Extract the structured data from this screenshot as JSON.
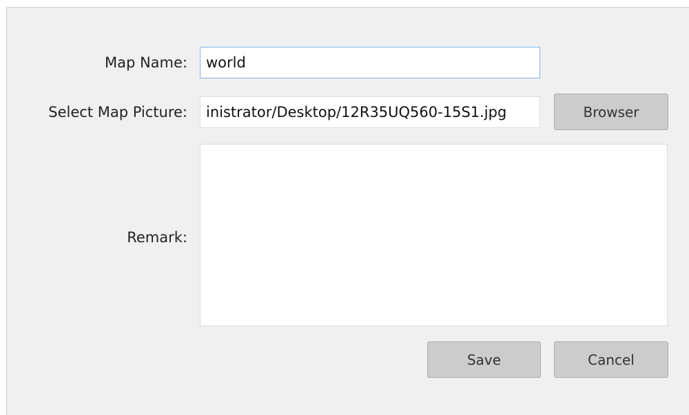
{
  "form": {
    "map_name_label": "Map Name:",
    "map_name_value": "world",
    "select_picture_label": "Select Map Picture:",
    "picture_path_value": "inistrator/Desktop/12R35UQ560-15S1.jpg",
    "browser_button": "Browser",
    "remark_label": "Remark:",
    "remark_value": ""
  },
  "actions": {
    "save_label": "Save",
    "cancel_label": "Cancel"
  }
}
